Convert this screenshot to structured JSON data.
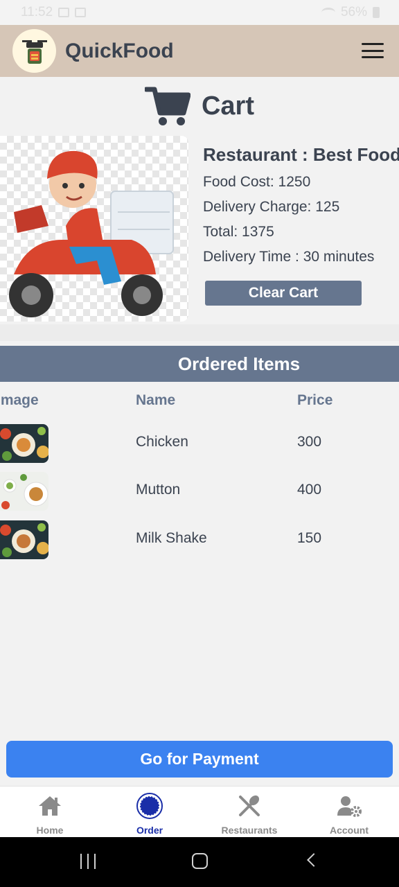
{
  "status_bar": {
    "time": "11:52",
    "battery": "56%"
  },
  "app": {
    "title": "QuickFood"
  },
  "page": {
    "title": "Cart"
  },
  "restaurant": {
    "name_line": "Restaurant : Best Food",
    "food_cost": "Food Cost: 1250",
    "delivery_charge": "Delivery Charge: 125",
    "total": "Total: 1375",
    "delivery_time": "Delivery Time : 30 minutes"
  },
  "clear_cart_label": "Clear Cart",
  "ordered_items": {
    "title": "Ordered Items",
    "columns": [
      "Image",
      "Name",
      "Price"
    ],
    "rows": [
      {
        "name": "Chicken",
        "price": "300"
      },
      {
        "name": "Mutton",
        "price": "400"
      },
      {
        "name": "Milk Shake",
        "price": "150"
      }
    ]
  },
  "payment_button_label": "Go for Payment",
  "bottom_nav": [
    {
      "label": "Home",
      "icon": "home-icon"
    },
    {
      "label": "Order",
      "icon": "order-icon",
      "active": true
    },
    {
      "label": "Restaurants",
      "icon": "utensils-icon"
    },
    {
      "label": "Account",
      "icon": "user-gear-icon"
    }
  ],
  "colors": {
    "accent": "#66768f",
    "header": "#d6c6b7",
    "primary_button": "#3b82f0",
    "active_nav": "#1a2ea8",
    "text": "#3b4350"
  }
}
